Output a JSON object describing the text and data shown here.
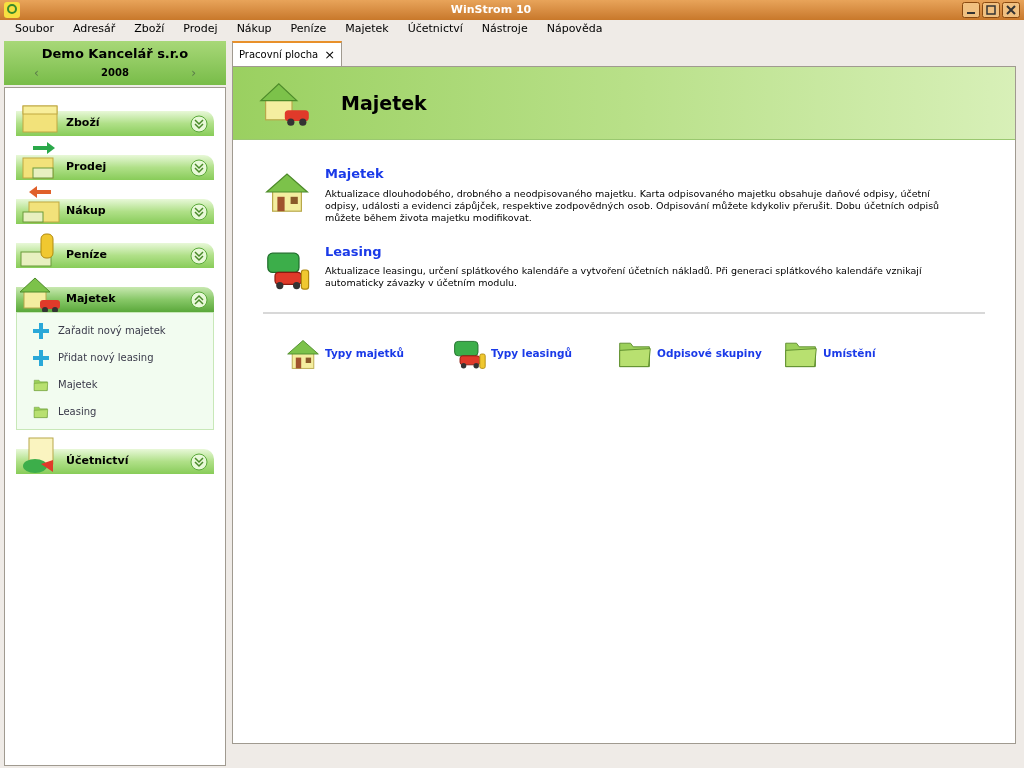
{
  "window": {
    "title": "WinStrom 10"
  },
  "menu": [
    "Soubor",
    "Adresář",
    "Zboží",
    "Prodej",
    "Nákup",
    "Peníze",
    "Majetek",
    "Účetnictví",
    "Nástroje",
    "Nápověda"
  ],
  "company": {
    "name": "Demo Kancelář s.r.o",
    "year": "2008",
    "prev": "‹",
    "next": "›"
  },
  "sidebar": [
    {
      "label": "Zboží",
      "kind": "goods",
      "expanded": false
    },
    {
      "label": "Prodej",
      "kind": "sales",
      "expanded": false
    },
    {
      "label": "Nákup",
      "kind": "purchase",
      "expanded": false
    },
    {
      "label": "Peníze",
      "kind": "money",
      "expanded": false
    },
    {
      "label": "Majetek",
      "kind": "assets",
      "expanded": true,
      "children": [
        {
          "label": "Zařadit nový majetek",
          "kind": "add"
        },
        {
          "label": "Přidat nový leasing",
          "kind": "add"
        },
        {
          "label": "Majetek",
          "kind": "folder"
        },
        {
          "label": "Leasing",
          "kind": "folder"
        }
      ]
    },
    {
      "label": "Účetnictví",
      "kind": "accounting",
      "expanded": false
    }
  ],
  "tabs": [
    {
      "label": "Pracovní plocha",
      "selected": true,
      "close": "×"
    }
  ],
  "banner": {
    "title": "Majetek"
  },
  "modules": [
    {
      "title": "Majetek",
      "kind": "house",
      "description": "Aktualizace dlouhodobého, drobného a neodpisovaného majetku. Karta odpisovaného majetku obsahuje daňové odpisy, účetní odpisy, události a evidenci zápůjček, respektive zodpovědných osob. Odpisování můžete kdykoliv přerušit. Dobu účetních odpisů můžete během života majetku modifikovat."
    },
    {
      "title": "Leasing",
      "kind": "car",
      "description": "Aktualizace leasingu, určení splátkového kalendáře a vytvoření účetních nákladů. Při generaci splátkového kalendáře vznikají automaticky závazky v účetním modulu."
    }
  ],
  "links": [
    {
      "label": "Typy majetků",
      "kind": "house"
    },
    {
      "label": "Typy leasingů",
      "kind": "car"
    },
    {
      "label": "Odpisové skupiny",
      "kind": "folder"
    },
    {
      "label": "Umístění",
      "kind": "folder"
    }
  ]
}
